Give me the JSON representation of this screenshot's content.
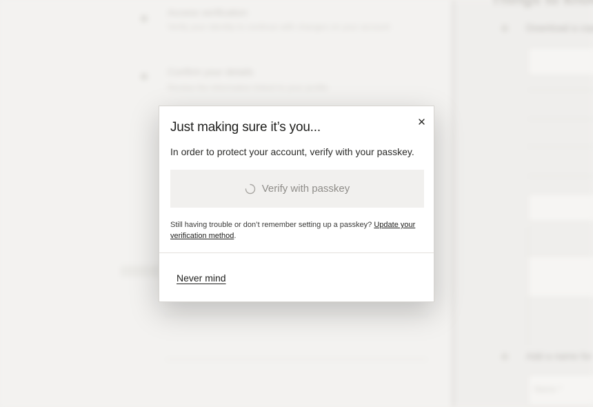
{
  "background": {
    "heading": "Things to know",
    "left_items": [
      {
        "title": "Access verification",
        "subtitle": "Verify your identity to continue with changes on your account"
      },
      {
        "title": "Confirm your details",
        "subtitle": "Review the information linked to your profile"
      }
    ],
    "right_items": [
      {
        "label": "Download a copy"
      },
      {
        "label": "Add a name for"
      }
    ],
    "field_placeholder": "Name *"
  },
  "modal": {
    "title": "Just making sure it’s you...",
    "close_icon": "close-icon",
    "description": "In order to protect your account, verify with your passkey.",
    "verify_button": {
      "label": "Verify with passkey",
      "icon": "spinner-icon",
      "state": "loading"
    },
    "help": {
      "text": "Still having trouble or don’t remember setting up a passkey?",
      "link": "Update your verification method",
      "suffix": "."
    },
    "secondary_action": "Never mind"
  },
  "colors": {
    "text": "#1d1d1b",
    "button_bg": "#f1f0ee",
    "button_text": "#8f8d89",
    "page_bg": "#f2f1ef"
  }
}
